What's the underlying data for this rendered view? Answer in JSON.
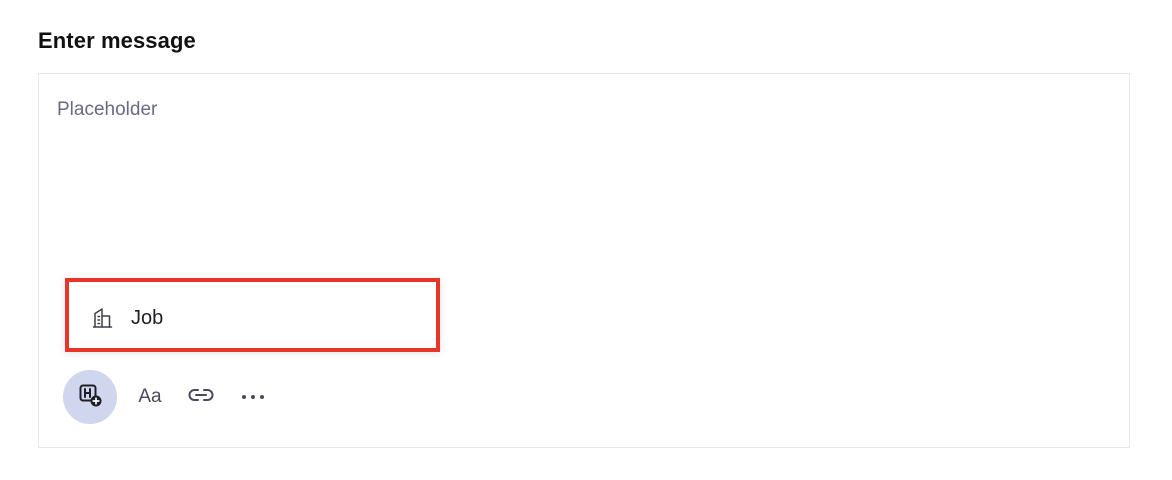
{
  "form": {
    "title": "Enter message"
  },
  "editor": {
    "value": "",
    "placeholder": "Placeholder"
  },
  "popup": {
    "items": [
      {
        "label": "Job",
        "icon": "building-icon"
      }
    ]
  },
  "toolbar": {
    "text_format_label": "Aa",
    "attach_icon": "attach-job-icon",
    "link_icon": "link-icon",
    "more_icon": "more-icon"
  },
  "colors": {
    "highlight_border": "#e8352a",
    "attach_button_bg": "#cfd6ee",
    "placeholder_text": "#6b6a86"
  }
}
